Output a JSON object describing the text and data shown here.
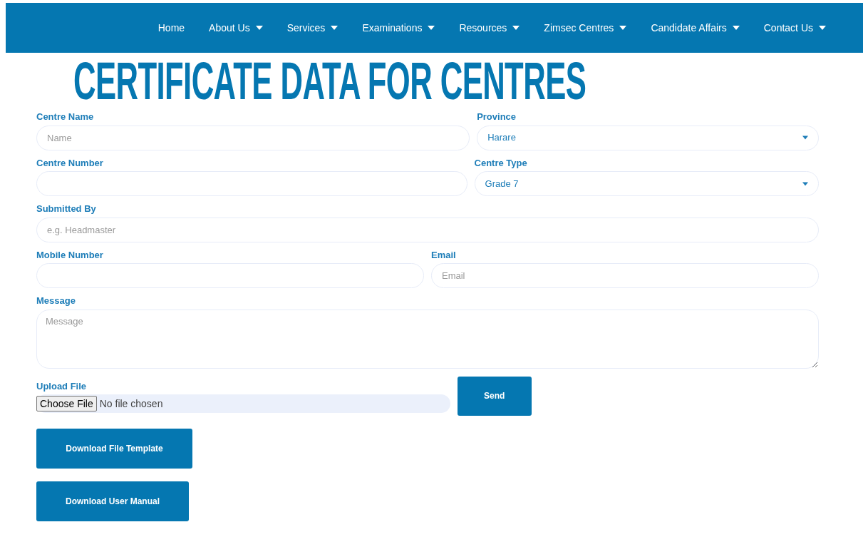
{
  "nav": [
    {
      "label": "Home",
      "dropdown": false
    },
    {
      "label": "About Us",
      "dropdown": true
    },
    {
      "label": "Services",
      "dropdown": true
    },
    {
      "label": "Examinations",
      "dropdown": true
    },
    {
      "label": "Resources",
      "dropdown": true
    },
    {
      "label": "Zimsec Centres",
      "dropdown": true
    },
    {
      "label": "Candidate Affairs",
      "dropdown": true
    },
    {
      "label": "Contact Us",
      "dropdown": true
    }
  ],
  "title": "CERTIFICATE DATA FOR CENTRES",
  "rows": [
    [
      {
        "kind": "text",
        "label": "Centre Name",
        "placeholder": "Name"
      },
      {
        "kind": "select",
        "label": "Province",
        "value": "Harare"
      }
    ],
    [
      {
        "kind": "text",
        "label": "Centre Number"
      },
      {
        "kind": "select",
        "label": "Centre Type",
        "value": "Grade 7"
      }
    ],
    [
      {
        "kind": "text",
        "label": "Submitted By",
        "placeholder": "e.g. Headmaster"
      }
    ],
    [
      {
        "kind": "text",
        "label": "Mobile Number"
      },
      {
        "kind": "text",
        "label": "Email",
        "placeholder": "Email"
      }
    ],
    [
      {
        "kind": "textarea",
        "label": "Message",
        "placeholder": "Message"
      }
    ],
    [
      {
        "kind": "file",
        "label": "Upload File",
        "button": "Choose File",
        "status": "No file chosen"
      },
      {
        "kind": "submit",
        "label": "Send"
      }
    ]
  ],
  "downloads": [
    "Download File Template",
    "Download User Manual"
  ]
}
